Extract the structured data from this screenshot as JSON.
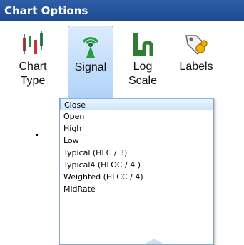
{
  "window": {
    "title": "Chart Options"
  },
  "toolbar": {
    "items": [
      {
        "label": "Chart\nType",
        "icon": "chart-type-icon",
        "active": false
      },
      {
        "label": "Signal",
        "icon": "signal-antenna-icon",
        "active": true
      },
      {
        "label": "Log\nScale",
        "icon": "log-scale-icon",
        "active": false
      },
      {
        "label": "Labels",
        "icon": "labels-tag-icon",
        "active": false
      }
    ]
  },
  "signal_menu": {
    "options": [
      "Close",
      "Open",
      "High",
      "Low",
      "Typical (HLC / 3)",
      "Typical4 (HLOC / 4 )",
      "Weighted (HLCC / 4)",
      "MidRate"
    ],
    "selected": "Close"
  },
  "colors": {
    "title_bar": "#1d4a8f",
    "active_tool": "#aed1f7",
    "selection": "#cfe6fb"
  }
}
